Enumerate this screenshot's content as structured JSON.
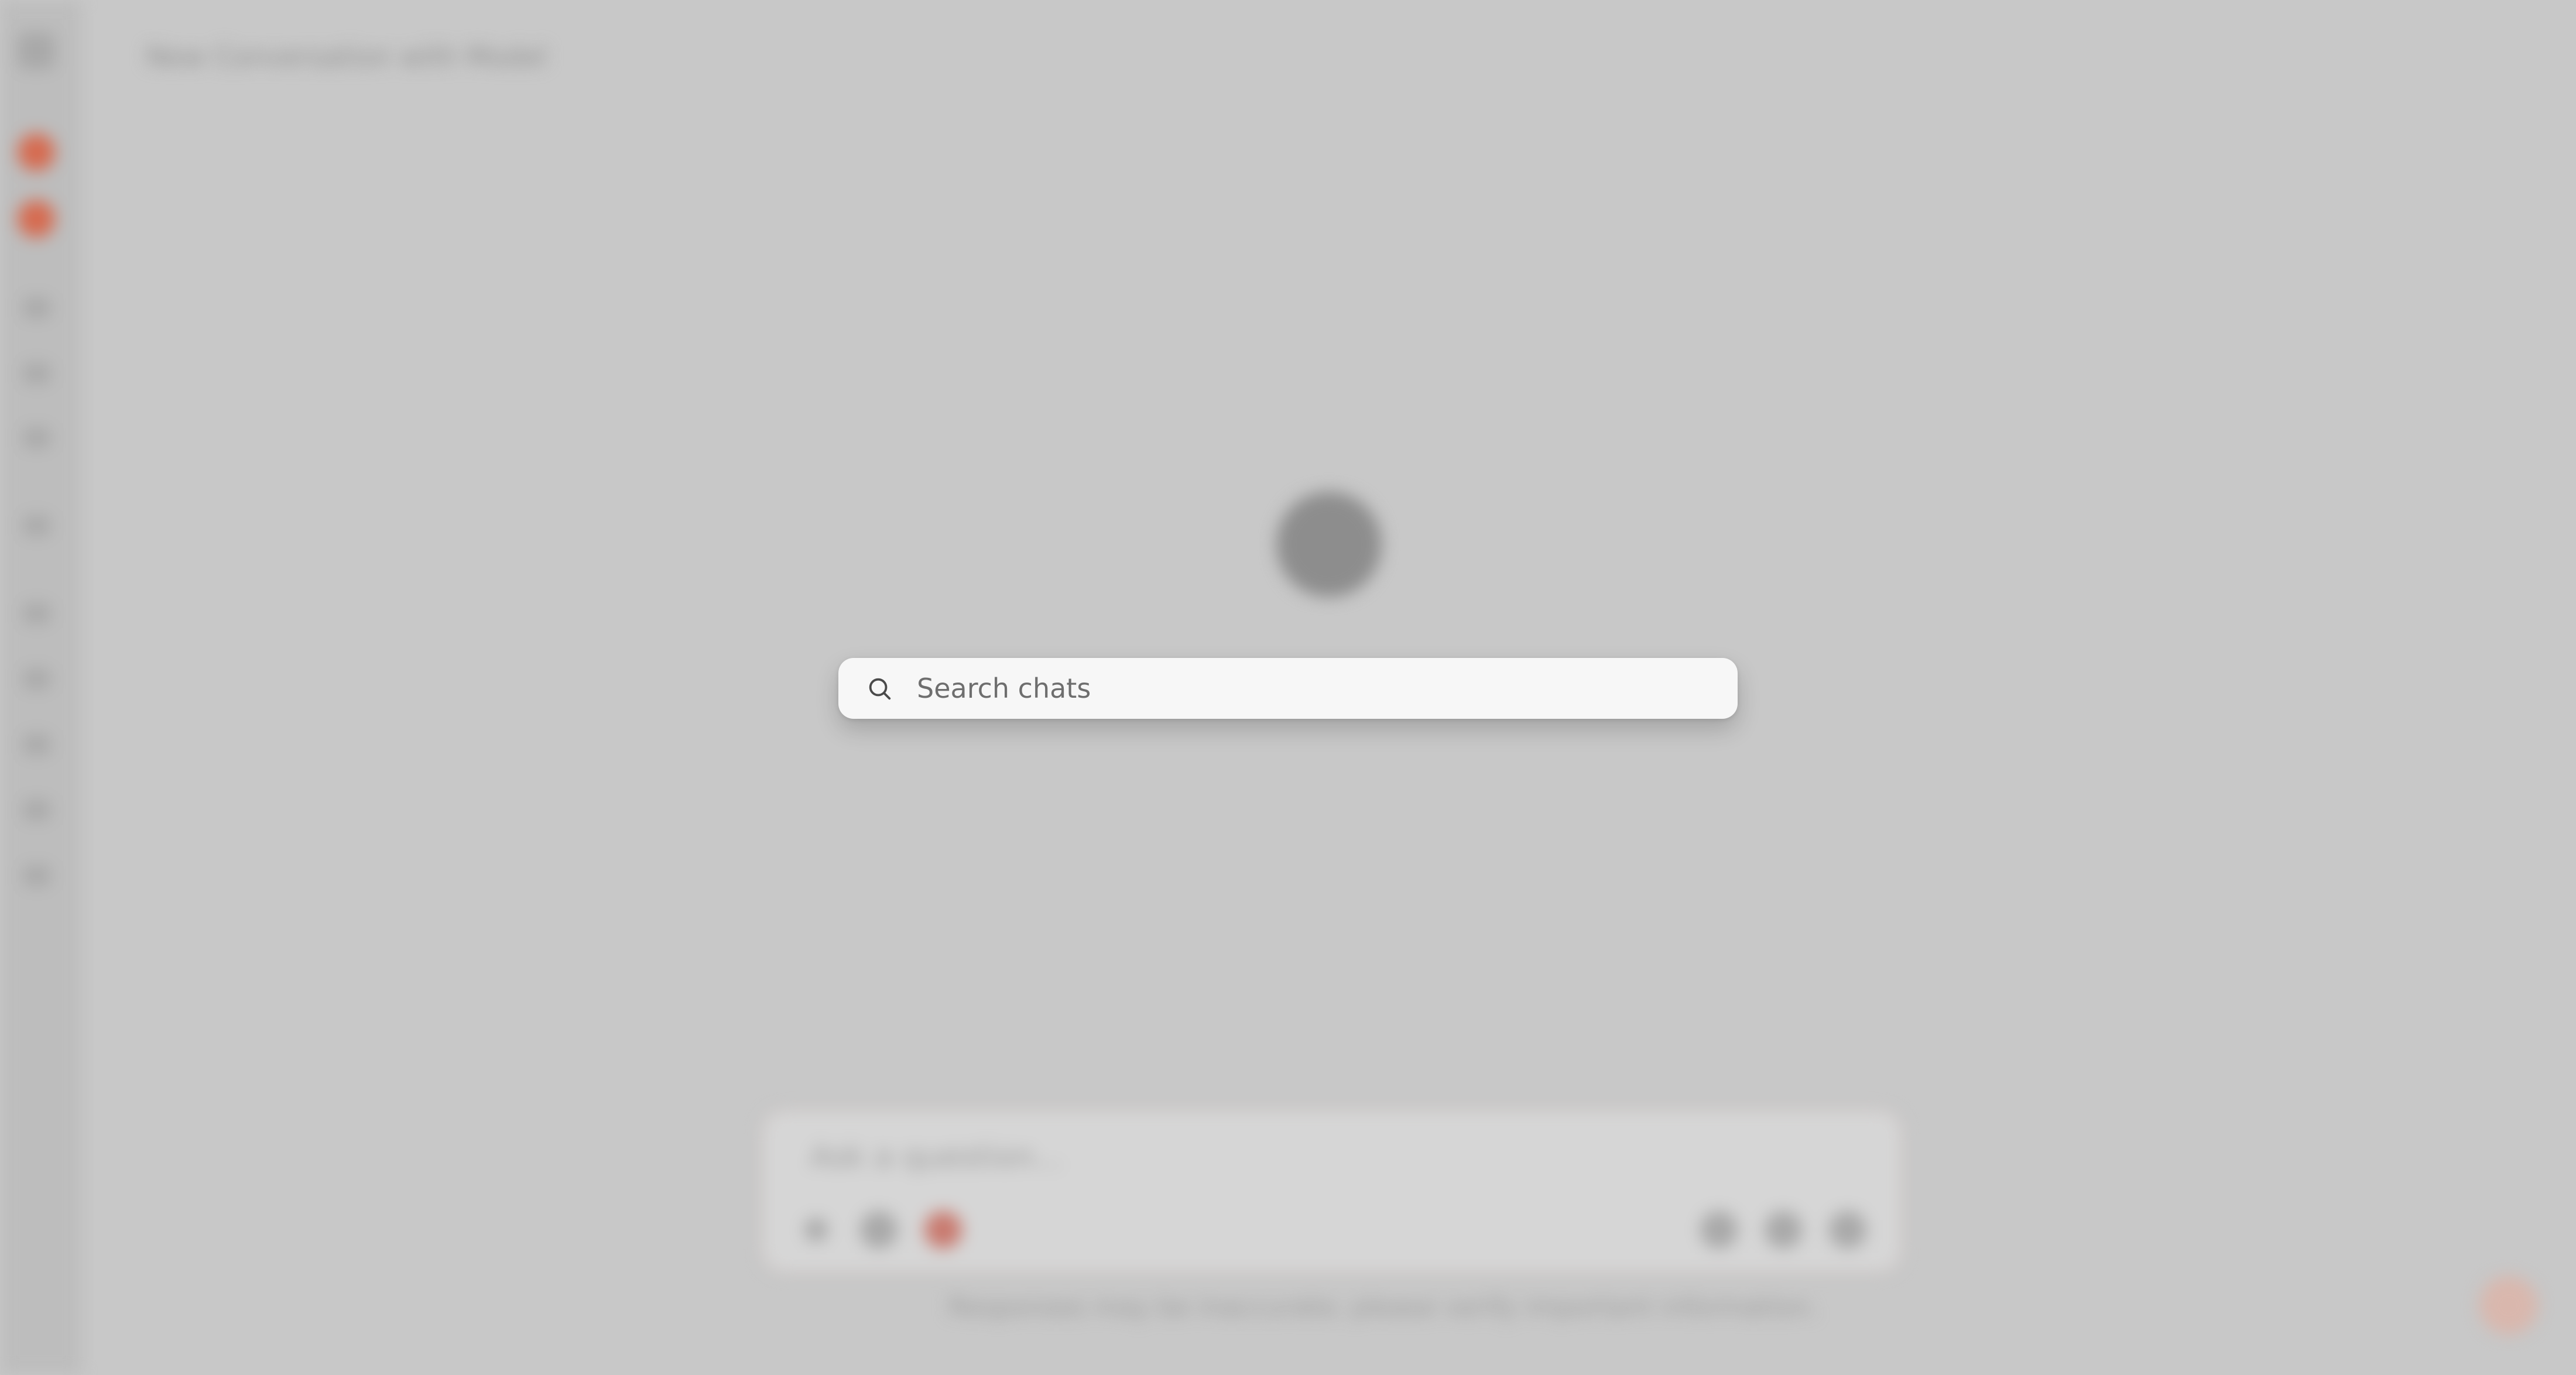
{
  "app": {
    "chat_title": "New Conversation with Model",
    "composer_placeholder": "Ask a question...",
    "footer_disclaimer": "Responses may be inaccurate; please verify important information."
  },
  "search": {
    "placeholder": "Search chats",
    "value": ""
  },
  "icons": {
    "search": "search-icon"
  },
  "colors": {
    "overlay_bg": "#c8c8c8",
    "modal_bg": "#f7f7f7",
    "accent": "#d66a4f",
    "placeholder_text": "#6e6e6e"
  }
}
